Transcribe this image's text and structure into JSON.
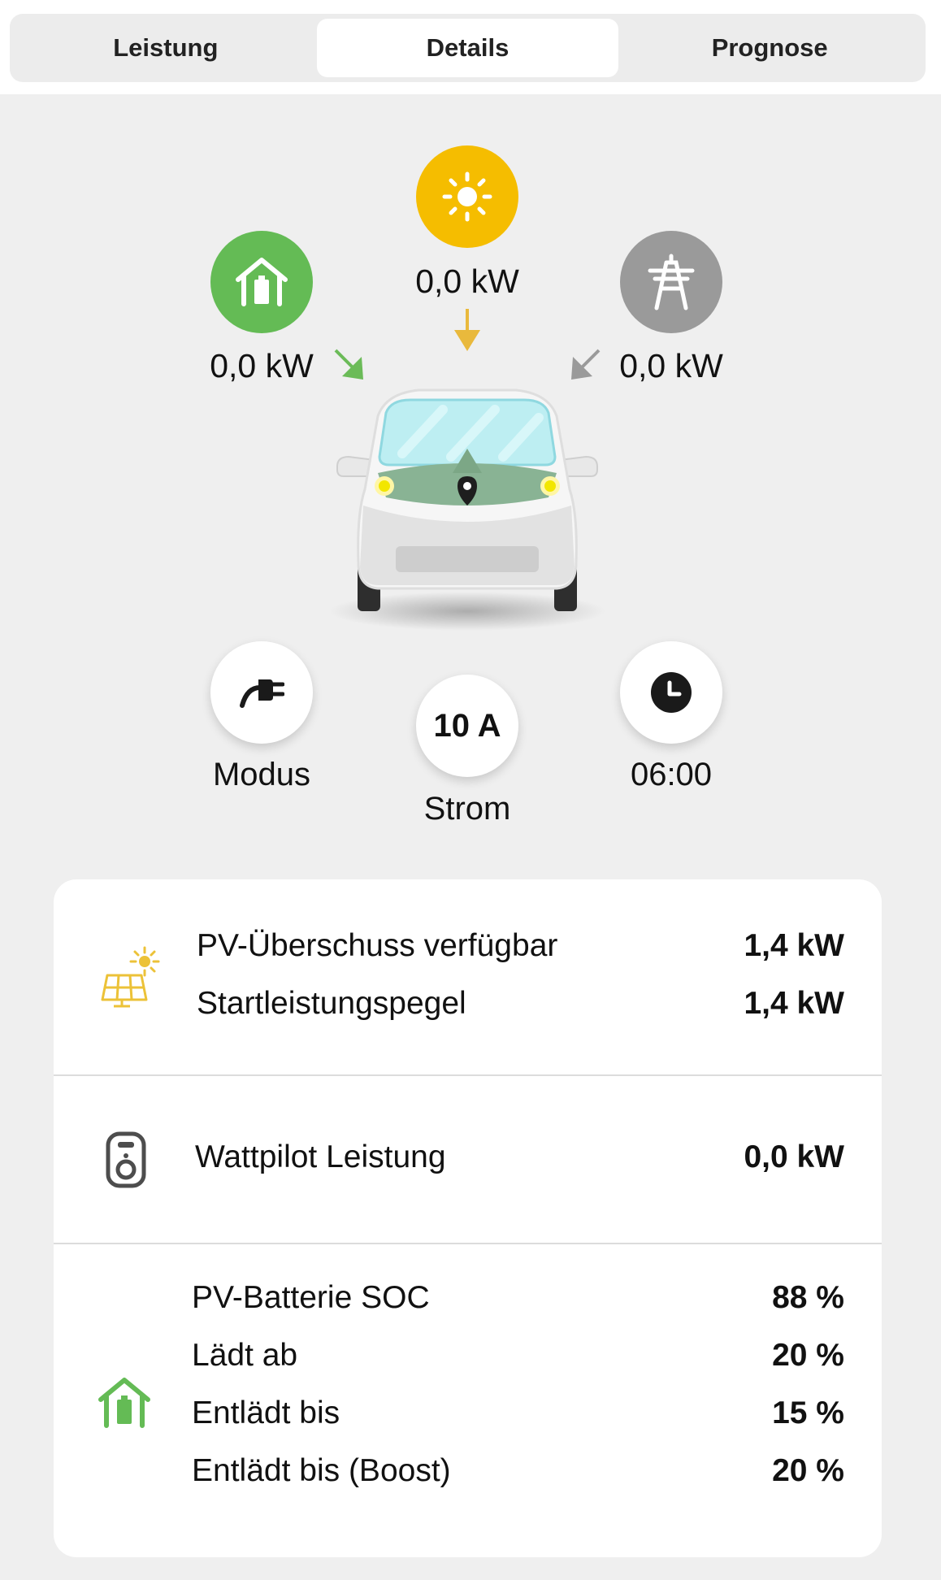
{
  "tabs": [
    {
      "label": "Leistung",
      "active": false
    },
    {
      "label": "Details",
      "active": true
    },
    {
      "label": "Prognose",
      "active": false
    }
  ],
  "energy_flow": {
    "home": {
      "value": "0,0 kW",
      "icon": "home-battery-icon",
      "color": "#64bb55"
    },
    "solar": {
      "value": "0,0 kW",
      "icon": "sun-icon",
      "color": "#f5bd00"
    },
    "grid": {
      "value": "0,0 kW",
      "icon": "power-tower-icon",
      "color": "#9a9a9a"
    }
  },
  "controls": {
    "mode": {
      "label": "Modus",
      "icon": "plug-icon"
    },
    "current": {
      "value": "10 A",
      "label": "Strom"
    },
    "time": {
      "value": "06:00",
      "icon": "clock-icon"
    }
  },
  "details": {
    "pv": {
      "icon": "solar-panel-icon",
      "rows": [
        {
          "label": "PV-Überschuss verfügbar",
          "value": "1,4 kW"
        },
        {
          "label": "Startleistungspegel",
          "value": "1,4 kW"
        }
      ]
    },
    "wattpilot": {
      "icon": "charger-icon",
      "rows": [
        {
          "label": "Wattpilot Leistung",
          "value": "0,0 kW"
        }
      ]
    },
    "battery": {
      "icon": "home-battery-icon",
      "rows": [
        {
          "label": "PV-Batterie SOC",
          "value": "88 %"
        },
        {
          "label": "Lädt ab",
          "value": "20 %"
        },
        {
          "label": "Entlädt bis",
          "value": "15 %"
        },
        {
          "label": "Entlädt bis (Boost)",
          "value": "20 %"
        }
      ]
    }
  },
  "colors": {
    "accent_green": "#64bb55",
    "accent_yellow": "#f5bd00",
    "grid_gray": "#9a9a9a",
    "background": "#efefef"
  }
}
